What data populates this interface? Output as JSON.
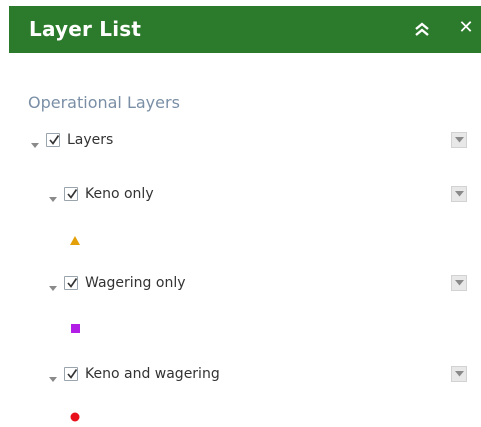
{
  "header": {
    "title": "Layer List",
    "bg_color": "#2c7a2c",
    "collapse_icon": "double-chevron-up-icon",
    "close_icon": "close-icon",
    "close_glyph": "✕"
  },
  "section_title": "Operational Layers",
  "layers": [
    {
      "label": "Layers",
      "checked": true,
      "expanded": true
    },
    {
      "label": "Keno only",
      "checked": true,
      "expanded": true,
      "legend_symbol": "triangle-icon",
      "legend_color": "#e3a008"
    },
    {
      "label": "Wagering only",
      "checked": true,
      "expanded": true,
      "legend_symbol": "square-icon",
      "legend_color": "#b31ee6"
    },
    {
      "label": "Keno and wagering",
      "checked": true,
      "expanded": true,
      "legend_symbol": "circle-icon",
      "legend_color": "#e8101a"
    }
  ]
}
